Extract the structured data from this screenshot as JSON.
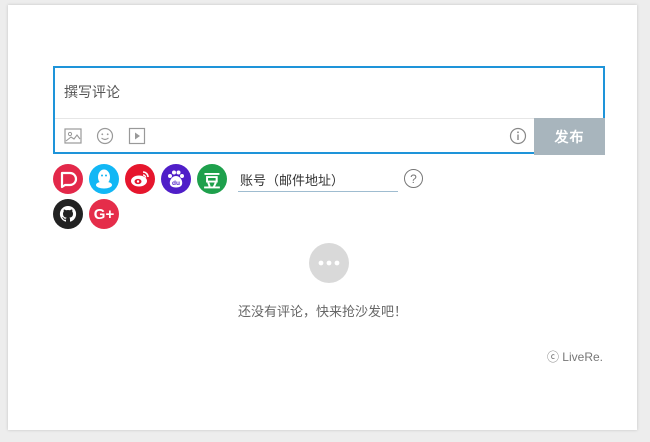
{
  "editor": {
    "placeholder": "撰写评论",
    "tools": [
      "image-icon",
      "emoji-icon",
      "video-icon",
      "info-icon"
    ],
    "post_label": "发布"
  },
  "login": {
    "providers": [
      {
        "name": "livere",
        "color": "#e3284a"
      },
      {
        "name": "qq",
        "color": "#12b7f5"
      },
      {
        "name": "weibo",
        "color": "#e6162d"
      },
      {
        "name": "baidu",
        "color": "#4f1ec8"
      },
      {
        "name": "douban",
        "color": "#1ea04c"
      },
      {
        "name": "github",
        "color": "#222222"
      },
      {
        "name": "google-plus",
        "color": "#e52d4a"
      }
    ],
    "account_placeholder": "账号（邮件地址）",
    "help_symbol": "?",
    "douban_glyph": "豆",
    "baidu_glyph": "du",
    "google_glyph": "G+"
  },
  "empty": {
    "message": "还没有评论，快来抢沙发吧！"
  },
  "footer": {
    "brand": "ⓒ LiveRe."
  },
  "colors": {
    "accent": "#1e94d9",
    "button": "#a8b5bd"
  }
}
